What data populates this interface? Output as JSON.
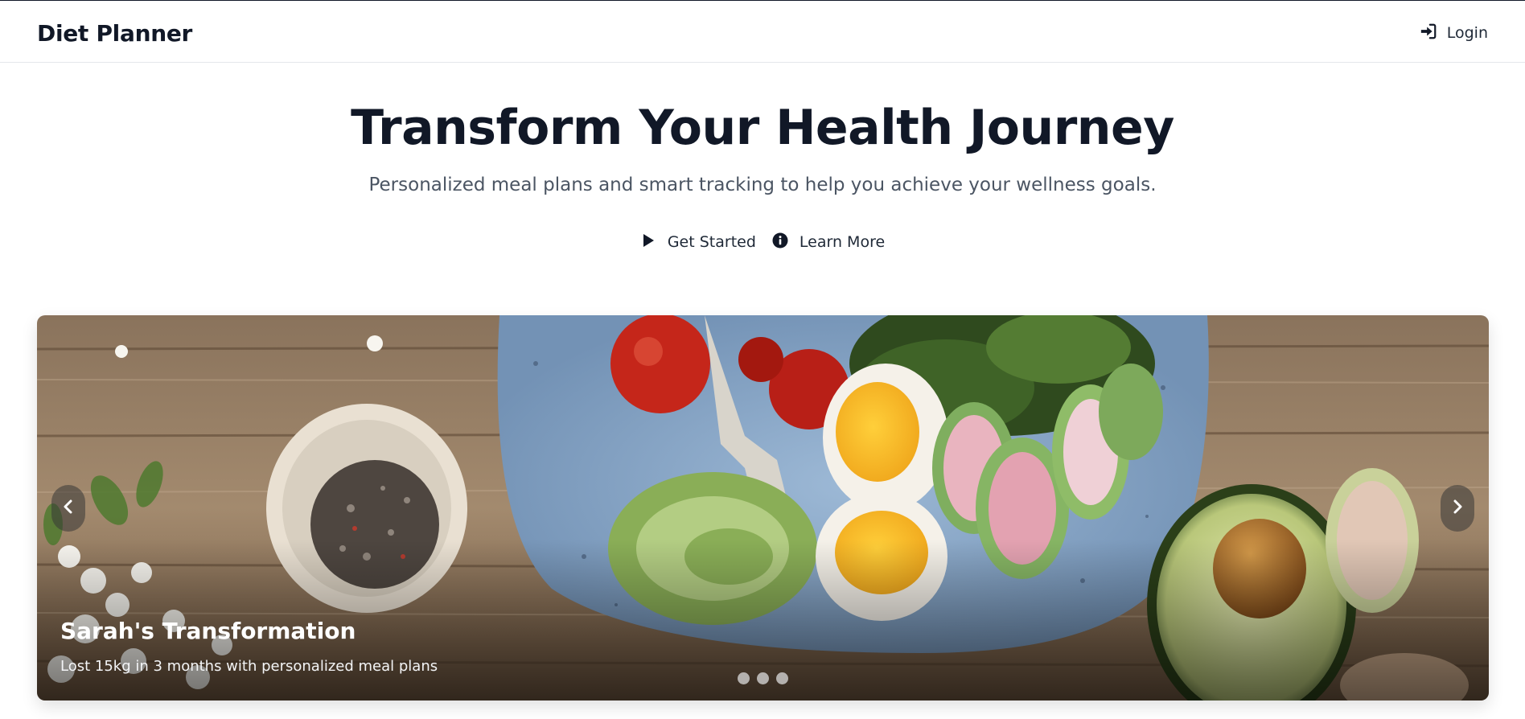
{
  "navbar": {
    "brand": "Diet Planner",
    "login_label": "Login",
    "login_icon": "sign-in-icon"
  },
  "hero": {
    "title": "Transform Your Health Journey",
    "subtitle": "Personalized meal plans and smart tracking to help you achieve your wellness goals.",
    "actions": [
      {
        "label": "Get Started",
        "icon": "play-icon"
      },
      {
        "label": "Learn More",
        "icon": "info-circle-icon"
      }
    ]
  },
  "carousel": {
    "slide_title": "Sarah's Transformation",
    "slide_description": "Lost 15kg in 3 months with personalized meal plans",
    "dot_count": 3,
    "prev_icon": "chevron-left-icon",
    "next_icon": "chevron-right-icon"
  },
  "colors": {
    "text_primary": "#111827",
    "text_secondary": "#4b5563",
    "border": "#e5e7eb"
  }
}
